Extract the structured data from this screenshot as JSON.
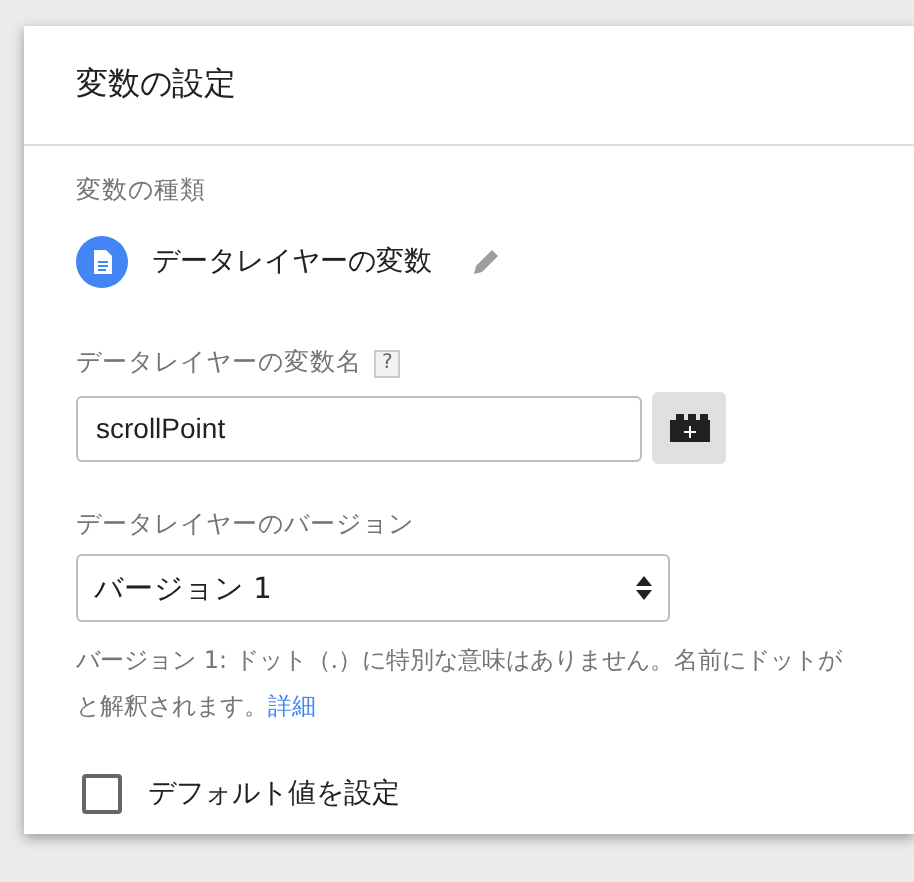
{
  "dialog": {
    "title": "変数の設定"
  },
  "variable_type": {
    "label": "変数の種類",
    "name": "データレイヤーの変数"
  },
  "variable_name": {
    "label": "データレイヤーの変数名",
    "help": "?",
    "value": "scrollPoint"
  },
  "version": {
    "label": "データレイヤーのバージョン",
    "value": "バージョン 1",
    "help_line_1": "バージョン 1: ドット（.）に特別な意味はありません。名前にドットが",
    "help_line_2": "と解釈されます。",
    "link": "詳細"
  },
  "default_value": {
    "label": "デフォルト値を設定",
    "checked": false
  }
}
